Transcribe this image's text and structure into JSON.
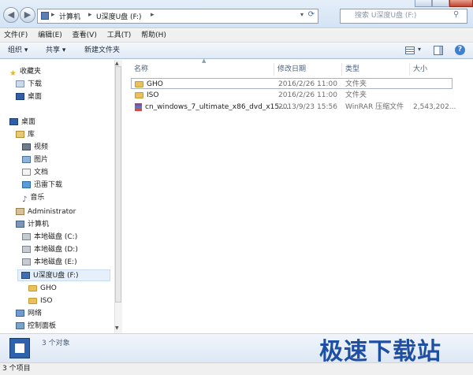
{
  "address": {
    "segments": [
      "计算机",
      "U深度U盘 (F:)"
    ],
    "search_placeholder": "搜索 U深度U盘 (F:)"
  },
  "menu": [
    "文件(F)",
    "编辑(E)",
    "查看(V)",
    "工具(T)",
    "帮助(H)"
  ],
  "toolbar": {
    "organize": "组织 ▾",
    "share": "共享 ▾",
    "new_folder": "新建文件夹"
  },
  "nav": {
    "favorites": "收藏夹",
    "downloads": "下载",
    "desktop_fav": "桌面",
    "desktop": "桌面",
    "library": "库",
    "videos": "视频",
    "pictures": "图片",
    "documents": "文档",
    "xunlei": "迅雷下载",
    "music": "音乐",
    "administrator": "Administrator",
    "computer": "计算机",
    "disk_c": "本地磁盘 (C:)",
    "disk_d": "本地磁盘 (D:)",
    "disk_e": "本地磁盘 (E:)",
    "disk_f": "U深度U盘 (F:)",
    "gho": "GHO",
    "iso": "ISO",
    "network": "网络",
    "control_panel": "控制面板"
  },
  "columns": [
    "名称",
    "修改日期",
    "类型",
    "大小"
  ],
  "files": [
    {
      "name": "GHO",
      "date": "2016/2/26 11:00",
      "type": "文件夹",
      "size": ""
    },
    {
      "name": "ISO",
      "date": "2016/2/26 11:00",
      "type": "文件夹",
      "size": ""
    },
    {
      "name": "cn_windows_7_ultimate_x86_dvd_x15-...",
      "date": "2013/9/23 15:56",
      "type": "WinRAR 压缩文件",
      "size": "2,543,202..."
    }
  ],
  "details": {
    "count": "3 个对象"
  },
  "status": {
    "text": "3 个项目"
  },
  "watermark": "极速下载站"
}
